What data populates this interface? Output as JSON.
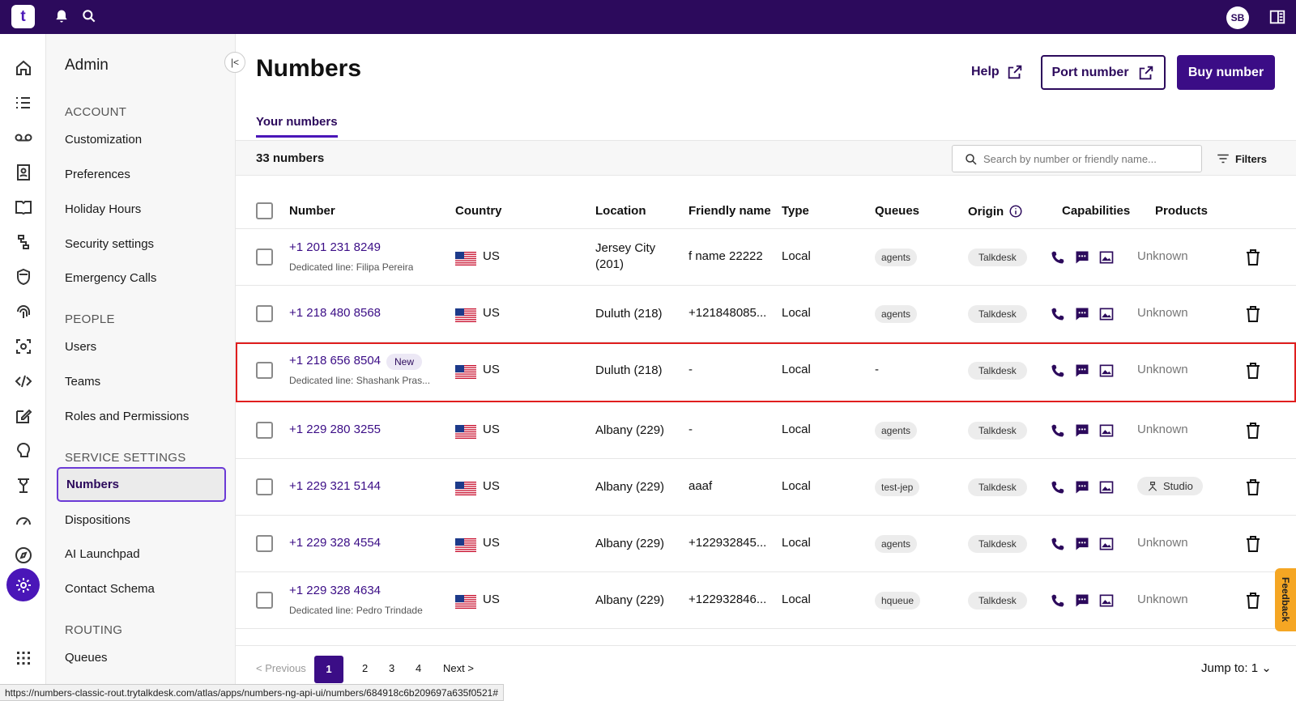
{
  "topbar": {
    "avatar": "SB",
    "logo": "t"
  },
  "subnav": {
    "title": "Admin",
    "sections": [
      {
        "heading": "ACCOUNT",
        "items": [
          "Customization",
          "Preferences",
          "Holiday Hours",
          "Security settings",
          "Emergency Calls"
        ]
      },
      {
        "heading": "PEOPLE",
        "items": [
          "Users",
          "Teams",
          "Roles and Permissions"
        ]
      },
      {
        "heading": "SERVICE SETTINGS",
        "items": [
          "Numbers",
          "Dispositions",
          "AI Launchpad",
          "Contact Schema"
        ]
      },
      {
        "heading": "ROUTING",
        "items": [
          "Queues"
        ]
      }
    ],
    "active": "Numbers"
  },
  "page": {
    "title": "Numbers",
    "help_label": "Help",
    "port_label": "Port number",
    "buy_label": "Buy number",
    "tab_label": "Your numbers",
    "count_label": "33 numbers",
    "search_placeholder": "Search by number or friendly name...",
    "filters_label": "Filters"
  },
  "table": {
    "headers": [
      "Number",
      "Country",
      "Location",
      "Friendly name",
      "Type",
      "Queues",
      "Origin",
      "Capabilities",
      "Products"
    ],
    "rows": [
      {
        "number": "+1 201 231 8249",
        "sub": "Dedicated line: Filipa Pereira",
        "new": "",
        "country": "US",
        "location": "Jersey City (201)",
        "friendly": "f name 22222",
        "type": "Local",
        "queue": "agents",
        "origin": "Talkdesk",
        "product": "Unknown"
      },
      {
        "number": "+1 218 480 8568",
        "sub": "",
        "new": "",
        "country": "US",
        "location": "Duluth (218)",
        "friendly": "+121848085...",
        "type": "Local",
        "queue": "agents",
        "origin": "Talkdesk",
        "product": "Unknown"
      },
      {
        "number": "+1 218 656 8504",
        "sub": "Dedicated line: Shashank Pras...",
        "new": "New",
        "country": "US",
        "location": "Duluth (218)",
        "friendly": "-",
        "type": "Local",
        "queue": "-",
        "origin": "Talkdesk",
        "product": "Unknown"
      },
      {
        "number": "+1 229 280 3255",
        "sub": "",
        "new": "",
        "country": "US",
        "location": "Albany (229)",
        "friendly": "-",
        "type": "Local",
        "queue": "agents",
        "origin": "Talkdesk",
        "product": "Unknown"
      },
      {
        "number": "+1 229 321 5144",
        "sub": "",
        "new": "",
        "country": "US",
        "location": "Albany (229)",
        "friendly": "aaaf",
        "type": "Local",
        "queue": "test-jep",
        "origin": "Talkdesk",
        "product": "Studio"
      },
      {
        "number": "+1 229 328 4554",
        "sub": "",
        "new": "",
        "country": "US",
        "location": "Albany (229)",
        "friendly": "+122932845...",
        "type": "Local",
        "queue": "agents",
        "origin": "Talkdesk",
        "product": "Unknown"
      },
      {
        "number": "+1 229 328 4634",
        "sub": "Dedicated line: Pedro Trindade",
        "new": "",
        "country": "US",
        "location": "Albany (229)",
        "friendly": "+122932846...",
        "type": "Local",
        "queue": "hqueue",
        "origin": "Talkdesk",
        "product": "Unknown"
      }
    ]
  },
  "pager": {
    "previous": "Previous",
    "pages": [
      "1",
      "2",
      "3",
      "4"
    ],
    "next": "Next",
    "jump_label": "Jump to:",
    "jump_value": "1"
  },
  "status_url": "https://numbers-classic-rout.trytalkdesk.com/atlas/apps/numbers-ng-api-ui/numbers/684918c6b209697a635f0521#",
  "feedback_label": "Feedback",
  "colors": {
    "brand": "#2c0a5c",
    "accent": "#4a16b8",
    "highlight": "#e01e1e"
  }
}
